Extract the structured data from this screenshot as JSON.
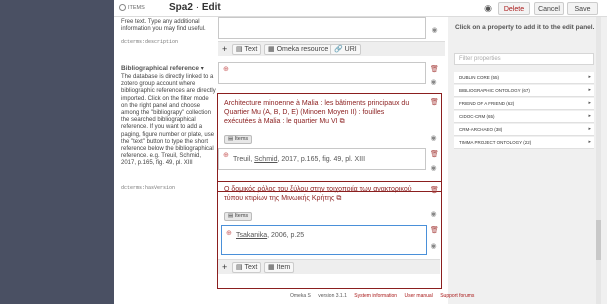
{
  "header": {
    "items_label": "ITEMS",
    "title": "Spa2",
    "separator": "·",
    "action": "Edit",
    "delete_label": "Delete",
    "cancel_label": "Cancel",
    "save_label": "Save"
  },
  "description_field": {
    "help": "Free text. Type any additional information you may find useful.",
    "term": "dcterms:description",
    "add_text": "Text",
    "add_resource": "Omeka resource",
    "add_uri": "URI"
  },
  "bibliographic_field": {
    "name": "Bibliographical reference",
    "help": "The database is directly linked to a zotero group account where bibliographic references are directly imported. Click on the filter mode on the right panel and choose among the \"bibliograpy\" collection the searched bibliographical reference. If you want to add a paging, figure number or plate, use the \"text\" button to type the short reference below the bibliographical reference. e.g. Treuil, Schmid, 2017, p.165, fig. 49, pl. XIII",
    "term": "dcterms:hasVersion",
    "value1": {
      "title": "Architecture minoenne à Malia : les bâtiments principaux du Quartier Mu (A, B, D, E) (Minoen Moyen II) : fouilles exécutées à Malia : le quartier Mu VI",
      "badge": "Items",
      "text_prefix": "Treuil, ",
      "text_link": "Schmid",
      "text_suffix": ", 2017, p.165, fig. 49, pl. XIII"
    },
    "value2": {
      "title": "Ο δομικός ρόλος του ξύλου στην τοιχοποιία των ανακτορικού τύπου κτιρίων της Μινωικής Κρήτης",
      "badge": "Items",
      "text_link": "Tsakanika",
      "text_suffix": ", 2006, p.25"
    },
    "add_text": "Text",
    "add_item": "Item"
  },
  "right_panel": {
    "intro": "Click on a property to add it to the edit panel.",
    "filter_placeholder": "Filter properties",
    "vocabularies": [
      "DUBLIN CORE (55)",
      "BIBLIOGRAPHIC ONTOLOGY (67)",
      "FRIEND OF A FRIEND (62)",
      "CIDOC-CRM (65)",
      "CRM-ARCHAEO (38)",
      "TIMMA PROJECT ONTOLOGY (22)"
    ]
  },
  "footer": {
    "app": "Omeka S",
    "version": "version 3.1.1",
    "system": "System information",
    "manual": "User manual",
    "forums": "Support forums"
  }
}
